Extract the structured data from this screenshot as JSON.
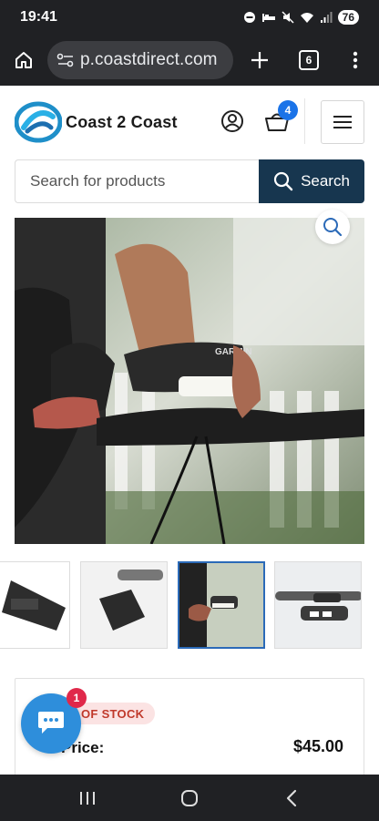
{
  "status": {
    "time": "19:41",
    "battery": "76"
  },
  "browser": {
    "url": "p.coastdirect.com",
    "tab_count": "6"
  },
  "header": {
    "logo_text": "Coast 2 Coast",
    "cart_count": "4"
  },
  "search": {
    "placeholder": "Search for products",
    "button_label": "Search"
  },
  "product": {
    "image_brand": "GARMIN",
    "stock_status": "OUT OF STOCK",
    "stock_visible": "OF STOCK",
    "price_label": "Price:",
    "price": "$45.00"
  },
  "chat": {
    "badge_count": "1"
  },
  "colors": {
    "accent_navy": "#17364f",
    "badge_blue": "#1a73e8",
    "chat_blue": "#2e8edb",
    "stock_red": "#c0392b"
  }
}
